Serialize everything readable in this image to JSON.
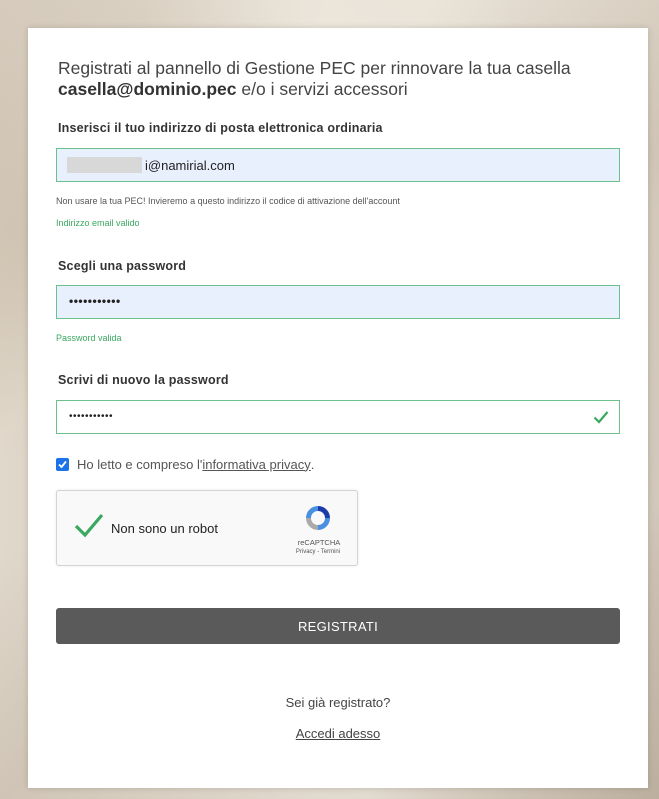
{
  "intro": {
    "text": "Registrati al pannello di Gestione PEC per rinnovare la tua casella",
    "mailbox": "casella@dominio.pec",
    "suffix": " e/o i servizi accessori"
  },
  "email": {
    "label": "Inserisci il tuo indirizzo di posta elettronica ordinaria",
    "value": "i@namirial.com",
    "hint": "Non usare la tua PEC! Invieremo a questo indirizzo il codice di attivazione dell'account",
    "status": "Indirizzo email valido"
  },
  "password": {
    "label": "Scegli una password",
    "value": "•••••••••••",
    "status": "Password valida"
  },
  "password_confirm": {
    "label": "Scrivi di nuovo la password",
    "value": "•••••••••••",
    "icon": "check-icon"
  },
  "privacy": {
    "checked": true,
    "prefix": "Ho letto e compreso l'",
    "link": "informativa privacy",
    "suffix": "."
  },
  "captcha": {
    "label": "Non sono un robot",
    "brand": "reCAPTCHA",
    "terms": "Privacy - Termini"
  },
  "submit": {
    "label": "REGISTRATI"
  },
  "footer": {
    "question": "Sei già registrato?",
    "login_link": "Accedi adesso"
  },
  "colors": {
    "valid": "#3aa860",
    "field_border": "#6cc08e",
    "autofill_bg": "#e8f0fe",
    "button_bg": "#5a5a5a"
  }
}
